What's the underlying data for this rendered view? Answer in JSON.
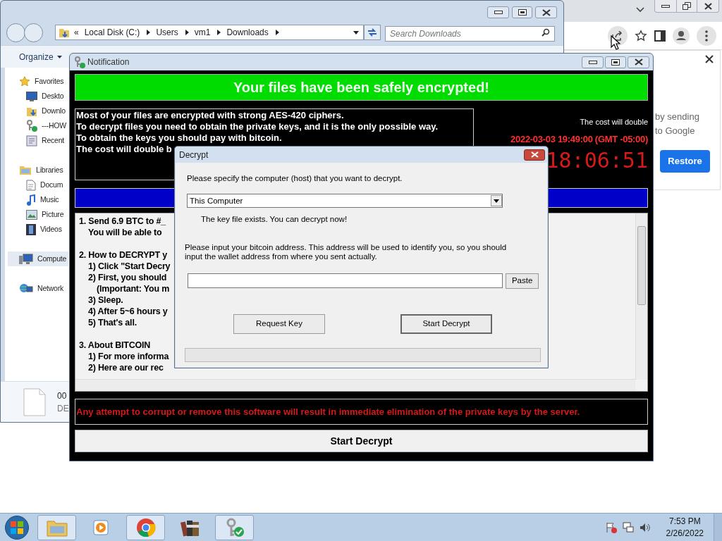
{
  "browser": {
    "panel": {
      "lines": [
        "by sending",
        "to Google"
      ],
      "button": "Restore"
    }
  },
  "explorer": {
    "address": {
      "overflow": "«",
      "crumbs": [
        "Local Disk (C:)",
        "Users",
        "vm1",
        "Downloads"
      ]
    },
    "search": {
      "placeholder": "Search Downloads"
    },
    "toolbar": [
      "Organize"
    ],
    "nav": [
      {
        "label": "Favorites",
        "kind": "star",
        "selected": false,
        "children": [
          {
            "label": "Deskto",
            "kind": "desktop",
            "selected": false
          },
          {
            "label": "Downlo",
            "kind": "download",
            "selected": false
          },
          {
            "label": "---HOW",
            "kind": "keys",
            "selected": false
          },
          {
            "label": "Recent",
            "kind": "recent",
            "selected": false
          }
        ]
      },
      {
        "label": "Libraries",
        "kind": "library",
        "selected": false,
        "children": [
          {
            "label": "Docum",
            "kind": "document",
            "selected": false
          },
          {
            "label": "Music",
            "kind": "music",
            "selected": false
          },
          {
            "label": "Picture",
            "kind": "picture",
            "selected": false
          },
          {
            "label": "Videos",
            "kind": "video",
            "selected": false
          }
        ]
      },
      {
        "label": "Compute",
        "kind": "computer",
        "selected": true
      },
      {
        "label": "Network",
        "kind": "network",
        "selected": false
      }
    ],
    "details": {
      "name": "00",
      "type": "DE"
    }
  },
  "notification": {
    "title": "Notification",
    "banner": "Your files have been safely encrypted!",
    "message": [
      "Most of your files are encrypted with strong AES-420 ciphers.",
      "To decrypt files you need to obtain the private keys, and it is the only possible way.",
      "To obtain the keys you should pay with bitcoin.",
      "The cost will double b"
    ],
    "cost_label": "The cost will double",
    "deadline": "2022-03-03 19:49:00 (GMT -05:00)",
    "countdown": "18:06:51",
    "instructions": [
      {
        "text": "1. Send 6.9 BTC to #_",
        "children": [
          {
            "text": "You will be able to"
          }
        ]
      },
      {
        "text": "2. How to DECRYPT y",
        "children": [
          {
            "text": "1) Click \"Start Decry"
          },
          {
            "text": "2) First, you should",
            "children": [
              {
                "text": "(Important: You m"
              }
            ]
          },
          {
            "text": "3) Sleep."
          },
          {
            "text": "4) After 5~6 hours y"
          },
          {
            "text": "5) That's all."
          }
        ]
      },
      {
        "text": "3. About BITCOIN",
        "children": [
          {
            "text": "1) For more informa"
          },
          {
            "text": "2) Here are our rec"
          }
        ]
      }
    ],
    "warning": "Any attempt to corrupt or remove this software will result in immediate elimination of the private keys by the server.",
    "button": "Start Decrypt"
  },
  "decrypt": {
    "title": "Decrypt",
    "host_label": "Please specify the computer (host) that you want to decrypt.",
    "host": "This Computer",
    "status": "The key file exists. You can decrypt now!",
    "address_label": "Please input your bitcoin address. This address will be used to identify you, so you should input the wallet address from where you sent actually.",
    "paste": "Paste",
    "request": "Request Key",
    "start": "Start Decrypt"
  },
  "taskbar": {
    "apps": [
      {
        "kind": "folder",
        "running": true
      },
      {
        "kind": "media",
        "running": false
      },
      {
        "kind": "browser",
        "running": true
      },
      {
        "kind": "archive",
        "running": false
      },
      {
        "kind": "keys",
        "running": true
      }
    ],
    "time": "7:53 PM",
    "date": "2/26/2022"
  }
}
